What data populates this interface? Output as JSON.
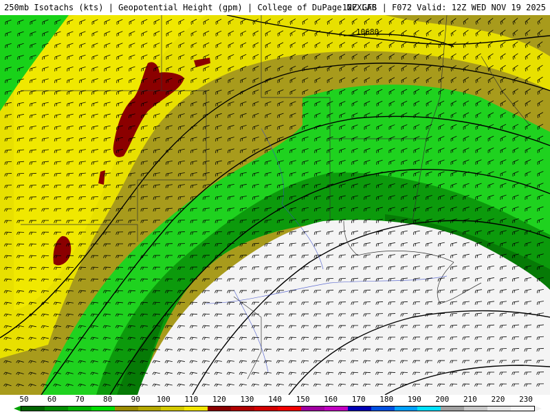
{
  "header": {
    "left_title": "250mb Isotachs (kts) | Geopotential Height (gpm) | College of DuPage NEXLAB",
    "right_title": "12Z GFS | F072 Valid: 12Z WED NOV 19 2025"
  },
  "map": {
    "contour_label": "10680",
    "barbs_icon": "wind-barb-icon",
    "city_icon": "city-marker-icon"
  },
  "colorbar": {
    "tick_labels": [
      "50",
      "60",
      "70",
      "80",
      "90",
      "100",
      "110",
      "120",
      "130",
      "140",
      "150",
      "160",
      "170",
      "180",
      "190",
      "200",
      "210",
      "220",
      "230"
    ],
    "colors": [
      "#006400",
      "#008c00",
      "#00b400",
      "#00dc00",
      "#9a8c00",
      "#b4a800",
      "#d2c800",
      "#f0e400",
      "#8b0000",
      "#b00000",
      "#d20000",
      "#f00000",
      "#a000a0",
      "#c000c0",
      "#0000b4",
      "#0050e0",
      "#00a0ff",
      "#00e0ff",
      "#a0a0a0",
      "#c8c8c8",
      "#e6e6e6",
      "#f5f5f5"
    ]
  }
}
